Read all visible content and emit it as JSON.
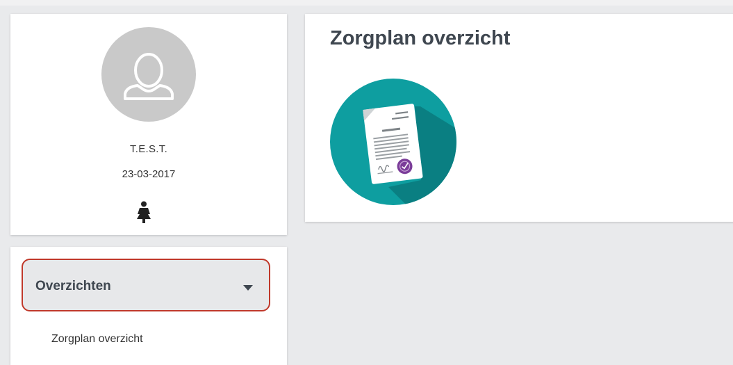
{
  "profile": {
    "name": "T.E.S.T.",
    "date": "23-03-2017",
    "avatar_icon": "user-silhouette-icon",
    "gender_icon": "female-person-icon"
  },
  "menu": {
    "section_label": "Overzichten",
    "caret_icon": "caret-down-icon",
    "items": [
      {
        "label": "Zorgplan overzicht"
      }
    ]
  },
  "main": {
    "title": "Zorgplan overzicht",
    "tile_icon": "signed-document-icon"
  },
  "colors": {
    "page_bg": "#e9eaec",
    "card_bg": "#ffffff",
    "title_text": "#3f4750",
    "highlight_border": "#c0392b",
    "tile_teal": "#0e9ea0",
    "seal_purple": "#7b3d99"
  }
}
